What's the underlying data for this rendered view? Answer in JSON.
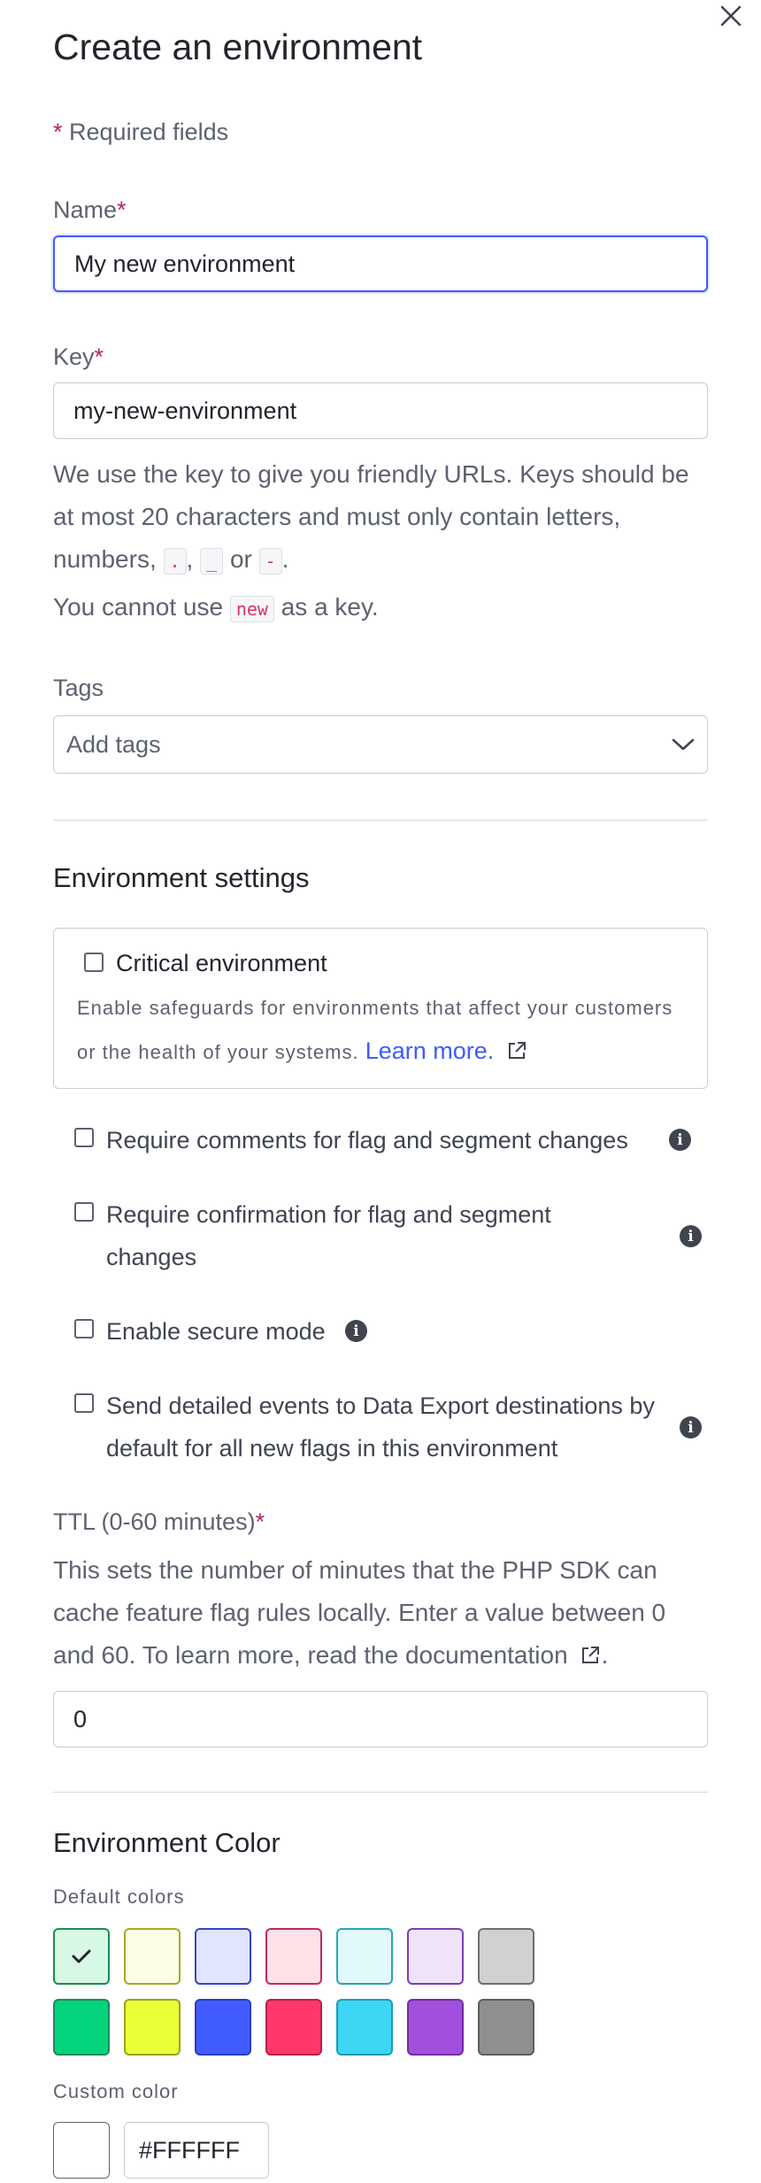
{
  "modal": {
    "title": "Create an environment",
    "required_star": "*",
    "required_note": "Required fields",
    "close_icon": "close-icon"
  },
  "name": {
    "label": "Name",
    "value": "My new environment"
  },
  "key": {
    "label": "Key",
    "value": "my-new-environment",
    "help_line1": "We use the key to give you friendly URLs. Keys should be at most 20 characters and must only contain letters, numbers,",
    "code_dot": ".",
    "sep_comma": ",",
    "code_underscore": "_",
    "sep_or": "or",
    "code_dash": "-",
    "end_period": ".",
    "help2_before": "You cannot use",
    "code_new": "new",
    "help2_after": "as a key."
  },
  "tags": {
    "label": "Tags",
    "placeholder": "Add tags",
    "icon": "chevron-down-icon"
  },
  "settings": {
    "title": "Environment settings",
    "critical_label": "Critical environment",
    "critical_desc": "Enable safeguards for environments that affect your customers or the health of your systems.",
    "learn_more": "Learn more.",
    "require_comments": "Require comments for flag and segment changes",
    "require_confirmation": "Require confirmation for flag and segment changes",
    "secure_mode": "Enable secure mode",
    "send_events": "Send detailed events to Data Export destinations by default for all new flags in this environment"
  },
  "ttl": {
    "label": "TTL (0-60 minutes)",
    "help": "This sets the number of minutes that the PHP SDK can cache feature flag rules locally. Enter a value between 0 and 60. To learn more, read the",
    "doc_link": "documentation",
    "end_period": ".",
    "value": "0"
  },
  "color": {
    "title": "Environment Color",
    "default_label": "Default colors",
    "custom_label": "Custom color",
    "custom_value": "#FFFFFF",
    "selected_index": 0,
    "light": [
      {
        "bg": "#d8f8e6",
        "border": "#1a8c4e"
      },
      {
        "bg": "#fbffe4",
        "border": "#a8a821"
      },
      {
        "bg": "#e1e5ff",
        "border": "#3344cc"
      },
      {
        "bg": "#ffe1e8",
        "border": "#c22b55"
      },
      {
        "bg": "#e2f9fc",
        "border": "#2aa5b8"
      },
      {
        "bg": "#efe3fa",
        "border": "#7a3fb8"
      },
      {
        "bg": "#d1d1d3",
        "border": "#6e6e72"
      }
    ],
    "dark": [
      {
        "bg": "#03d47c",
        "border": "#1b8a57"
      },
      {
        "bg": "#ebff38",
        "border": "#9aa31a"
      },
      {
        "bg": "#405bff",
        "border": "#2a3cc0"
      },
      {
        "bg": "#ff386b",
        "border": "#b81f47"
      },
      {
        "bg": "#3dd6f5",
        "border": "#1f9bb3"
      },
      {
        "bg": "#a34fde",
        "border": "#6e2ea3"
      },
      {
        "bg": "#8f8f92",
        "border": "#5d5d60"
      }
    ]
  }
}
